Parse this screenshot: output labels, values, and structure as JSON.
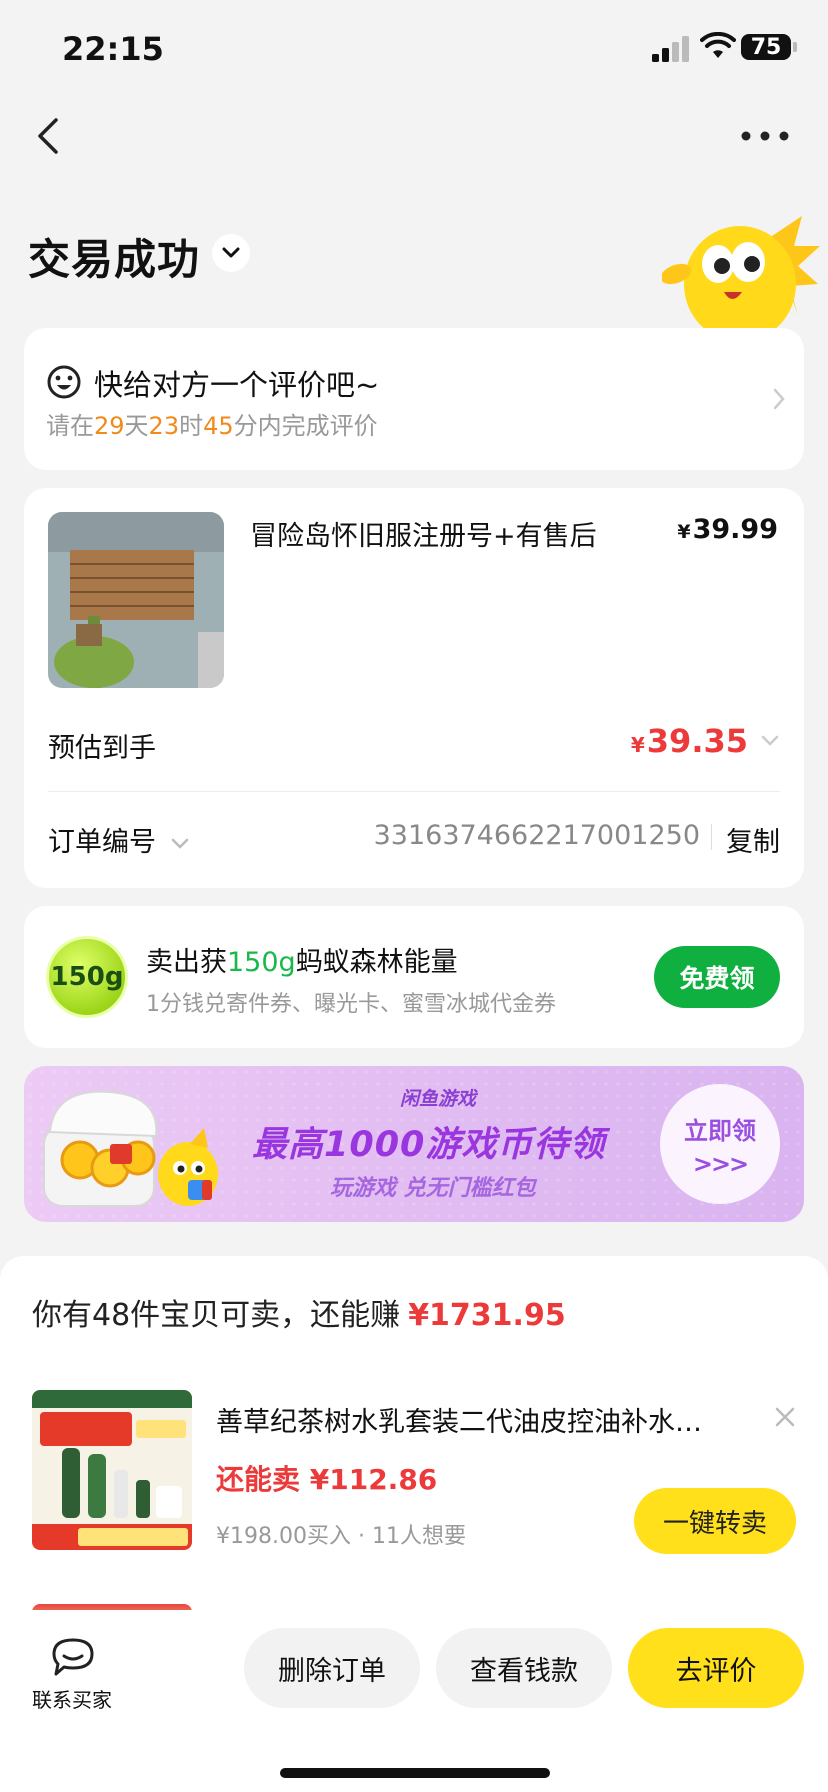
{
  "status_bar": {
    "time": "22:15",
    "battery": "75"
  },
  "header": {
    "title": "交易成功"
  },
  "evaluation": {
    "title": "快给对方一个评价吧~",
    "sub_prefix": "请在",
    "days": "29",
    "day_unit": "天",
    "hours": "23",
    "hour_unit": "时",
    "minutes": "45",
    "minute_suffix": "分内完成评价"
  },
  "order": {
    "product_name": "冒险岛怀旧服注册号+有售后",
    "price_symbol": "¥",
    "price": "39.99",
    "estimated_label": "预估到手",
    "estimated_symbol": "¥",
    "estimated_value": "39.35",
    "order_no_label": "订单编号",
    "order_no": "3316374662217001250",
    "copy_label": "复制"
  },
  "energy": {
    "badge": "150g",
    "title_prefix": "卖出获",
    "title_amount": "150g",
    "title_suffix": "蚂蚁森林能量",
    "subtitle": "1分钱兑寄件券、曝光卡、蜜雪冰城代金券",
    "button": "免费领"
  },
  "banner": {
    "brand": "闲鱼游戏",
    "headline": "最高1000游戏币待领",
    "subline": "玩游戏 兑无门槛红包",
    "cta": "立即领",
    "cta_arrows": ">>>"
  },
  "resale": {
    "title": "你有48件宝贝可卖，还能赚",
    "title_amount": "¥1731.95",
    "item": {
      "name": "善草纪茶树水乳套装二代油皮控油补水…",
      "price": "还能卖 ¥112.86",
      "bought": "¥198.00买入 · 11人想要",
      "button": "一键转卖"
    }
  },
  "bottom_bar": {
    "contact": "联系买家",
    "delete": "删除订单",
    "view_money": "查看钱款",
    "review": "去评价"
  },
  "colors": {
    "accent_yellow": "#ffe01a",
    "price_red": "#ec3a3a",
    "green": "#10b040",
    "orange": "#f08a1b",
    "purple": "#9a36e0"
  }
}
